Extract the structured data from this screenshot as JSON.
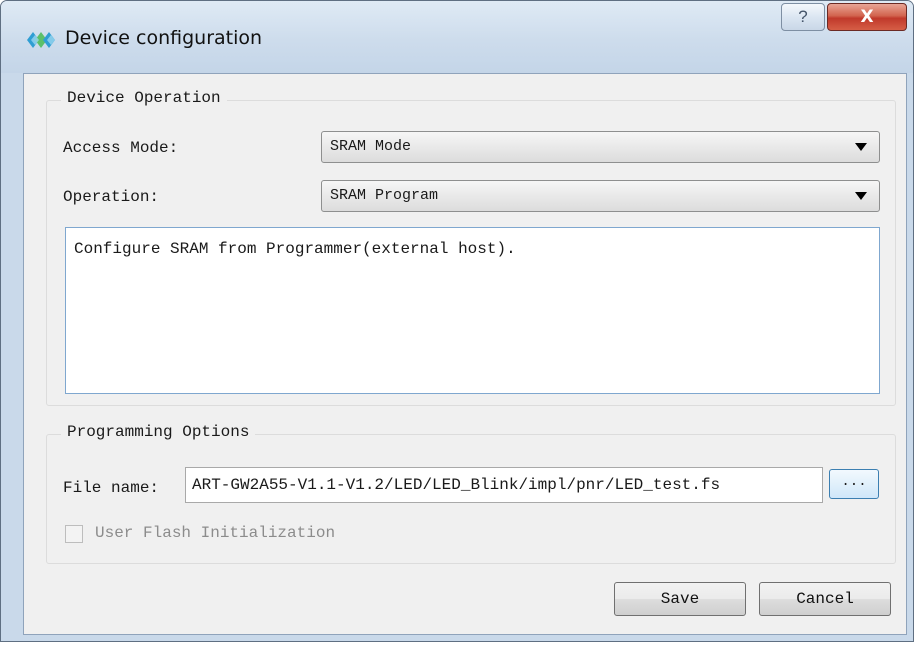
{
  "window": {
    "title": "Device configuration",
    "help_label": "?",
    "close_label": "X"
  },
  "device_operation": {
    "group_title": "Device Operation",
    "access_mode_label": "Access Mode:",
    "access_mode_value": "SRAM Mode",
    "operation_label": "Operation:",
    "operation_value": "SRAM Program",
    "description": "Configure SRAM from Programmer(external host)."
  },
  "programming_options": {
    "group_title": "Programming Options",
    "file_name_label": "File name:",
    "file_name_value": "ART-GW2A55-V1.1-V1.2/LED/LED_Blink/impl/pnr/LED_test.fs",
    "browse_label": "...",
    "user_flash_label": "User Flash Initialization",
    "user_flash_checked": false
  },
  "buttons": {
    "save_label": "Save",
    "cancel_label": "Cancel"
  },
  "colors": {
    "title_gradient": "#cddcec",
    "close_button": "#c0392b",
    "dialog_background": "#f0f0f0",
    "text_box_border": "#7fa7cf"
  },
  "icons": {
    "app": "gowin-logo-icon",
    "help": "question-mark-icon",
    "close": "close-icon",
    "dropdown": "chevron-down-icon"
  }
}
